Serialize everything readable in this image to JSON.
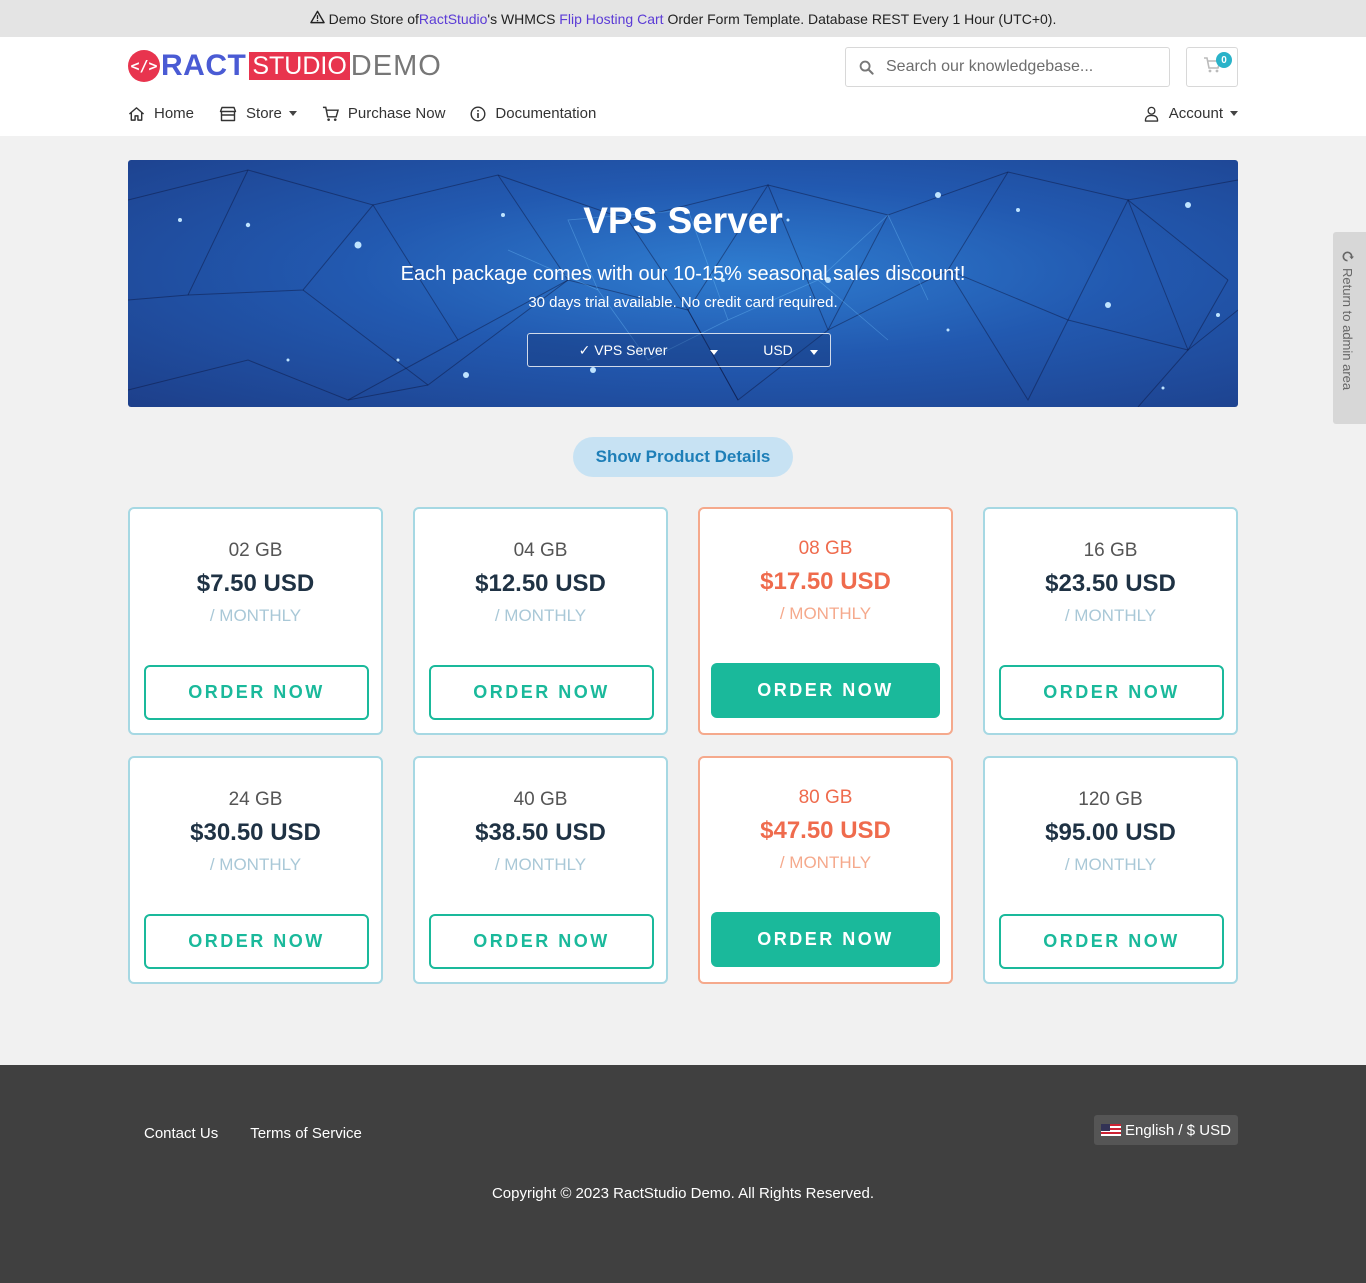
{
  "topbar": {
    "prefix": "Demo Store of ",
    "brand_link": "RactStudio",
    "middle": "'s WHMCS ",
    "template_link": "Flip Hosting Cart",
    "suffix": " Order Form Template. Database REST Every 1 Hour (UTC+0)."
  },
  "logo": {
    "badge": "</>",
    "ract": "RACT",
    "studio": "STUDIO",
    "demo": "DEMO"
  },
  "search": {
    "placeholder": "Search our knowledgebase..."
  },
  "cart": {
    "count": "0"
  },
  "nav": [
    {
      "label": "Home",
      "icon": "home-icon"
    },
    {
      "label": "Store",
      "icon": "store-icon"
    },
    {
      "label": "Purchase Now",
      "icon": "cart-icon"
    },
    {
      "label": "Documentation",
      "icon": "info-icon"
    }
  ],
  "account": {
    "label": "Account"
  },
  "hero": {
    "title": "VPS Server",
    "subtitle": "Each package comes with our 10-15% seasonal sales discount!",
    "subtitle2": "30 days trial available. No credit card required.",
    "category": "✓ VPS Server",
    "currency": "USD"
  },
  "details_button": "Show Product Details",
  "plans": [
    {
      "size": "02 GB",
      "price": "$7.50 USD",
      "cycle": "/ MONTHLY",
      "button": "ORDER NOW",
      "highlight": false
    },
    {
      "size": "04 GB",
      "price": "$12.50 USD",
      "cycle": "/ MONTHLY",
      "button": "ORDER NOW",
      "highlight": false
    },
    {
      "size": "08 GB",
      "price": "$17.50 USD",
      "cycle": "/ MONTHLY",
      "button": "ORDER NOW",
      "highlight": true
    },
    {
      "size": "16 GB",
      "price": "$23.50 USD",
      "cycle": "/ MONTHLY",
      "button": "ORDER NOW",
      "highlight": false
    },
    {
      "size": "24 GB",
      "price": "$30.50 USD",
      "cycle": "/ MONTHLY",
      "button": "ORDER NOW",
      "highlight": false
    },
    {
      "size": "40 GB",
      "price": "$38.50 USD",
      "cycle": "/ MONTHLY",
      "button": "ORDER NOW",
      "highlight": false
    },
    {
      "size": "80 GB",
      "price": "$47.50 USD",
      "cycle": "/ MONTHLY",
      "button": "ORDER NOW",
      "highlight": true
    },
    {
      "size": "120 GB",
      "price": "$95.00 USD",
      "cycle": "/ MONTHLY",
      "button": "ORDER NOW",
      "highlight": false
    }
  ],
  "footer": {
    "links": [
      "Contact Us",
      "Terms of Service"
    ],
    "language": "English / $ USD",
    "copyright": "Copyright © 2023 RactStudio Demo. All Rights Reserved."
  },
  "admin_tab": "Return to admin area",
  "colors": {
    "accent_green": "#1ab99b",
    "highlight_orange": "#ef6b4d",
    "card_border": "#a6d8e3",
    "brand_red": "#e8344e",
    "brand_blue": "#4a5bd4"
  }
}
